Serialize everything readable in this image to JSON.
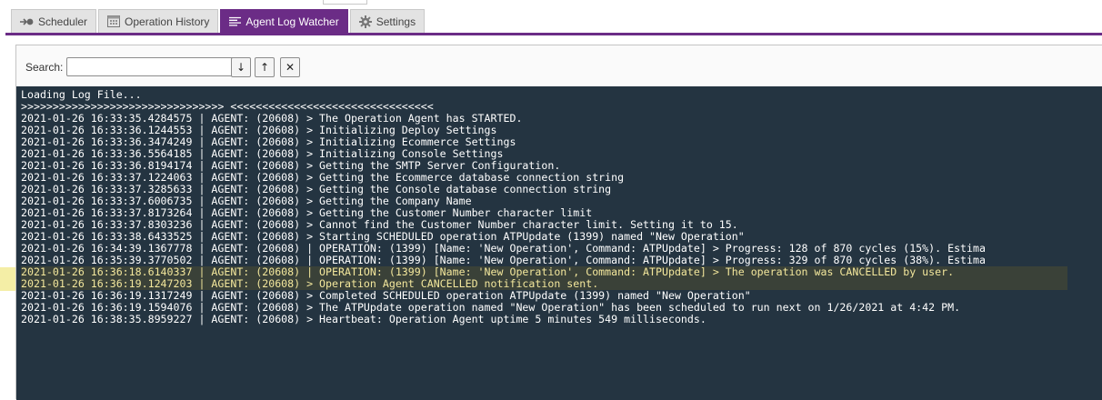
{
  "tabs": [
    {
      "label": "Scheduler",
      "icon": "arrow-dot-icon",
      "active": false
    },
    {
      "label": "Operation History",
      "icon": "calendar-icon",
      "active": false
    },
    {
      "label": "Agent Log Watcher",
      "icon": "list-icon",
      "active": true
    },
    {
      "label": "Settings",
      "icon": "gear-icon",
      "active": false
    }
  ],
  "colors": {
    "accent": "#6b2c86",
    "log_background": "#243441",
    "log_text": "#ffffff",
    "log_highlight_text": "#f3e79c"
  },
  "search": {
    "label": "Search:",
    "value": "",
    "placeholder": "",
    "next_icon": "↓",
    "prev_icon": "↑",
    "clear_icon": "✕"
  },
  "log": {
    "lines": [
      "Loading Log File...",
      ">>>>>>>>>>>>>>>>>>>>>>>>>>>>>>>> <<<<<<<<<<<<<<<<<<<<<<<<<<<<<<<<",
      "2021-01-26 16:33:35.4284575 | AGENT: (20608) > The Operation Agent has STARTED.",
      "2021-01-26 16:33:36.1244553 | AGENT: (20608) > Initializing Deploy Settings",
      "2021-01-26 16:33:36.3474249 | AGENT: (20608) > Initializing Ecommerce Settings",
      "2021-01-26 16:33:36.5564185 | AGENT: (20608) > Initializing Console Settings",
      "2021-01-26 16:33:36.8194174 | AGENT: (20608) > Getting the SMTP Server Configuration.",
      "2021-01-26 16:33:37.1224063 | AGENT: (20608) > Getting the Ecommerce database connection string",
      "2021-01-26 16:33:37.3285633 | AGENT: (20608) > Getting the Console database connection string",
      "2021-01-26 16:33:37.6006735 | AGENT: (20608) > Getting the Company Name",
      "2021-01-26 16:33:37.8173264 | AGENT: (20608) > Getting the Customer Number character limit",
      "2021-01-26 16:33:37.8303236 | AGENT: (20608) > Cannot find the Customer Number character limit. Setting it to 15.",
      "2021-01-26 16:33:38.6433525 | AGENT: (20608) > Starting SCHEDULED operation ATPUpdate (1399) named \"New Operation\"",
      "2021-01-26 16:34:39.1367778 | AGENT: (20608) | OPERATION: (1399) [Name: 'New Operation', Command: ATPUpdate] > Progress: 128 of 870 cycles (15%). Estima",
      "2021-01-26 16:35:39.3770502 | AGENT: (20608) | OPERATION: (1399) [Name: 'New Operation', Command: ATPUpdate] > Progress: 329 of 870 cycles (38%). Estima",
      "2021-01-26 16:36:18.6140337 | AGENT: (20608) | OPERATION: (1399) [Name: 'New Operation', Command: ATPUpdate] > The operation was CANCELLED by user.",
      "2021-01-26 16:36:19.1247203 | AGENT: (20608) > Operation Agent CANCELLED notification sent.",
      "2021-01-26 16:36:19.1317249 | AGENT: (20608) > Completed SCHEDULED operation ATPUpdate (1399) named \"New Operation\"",
      "2021-01-26 16:36:19.1594076 | AGENT: (20608) > The ATPUpdate operation named \"New Operation\" has been scheduled to run next on 1/26/2021 at 4:42 PM.",
      "2021-01-26 16:38:35.8959227 | AGENT: (20608) > Heartbeat: Operation Agent uptime 5 minutes 549 milliseconds."
    ]
  }
}
